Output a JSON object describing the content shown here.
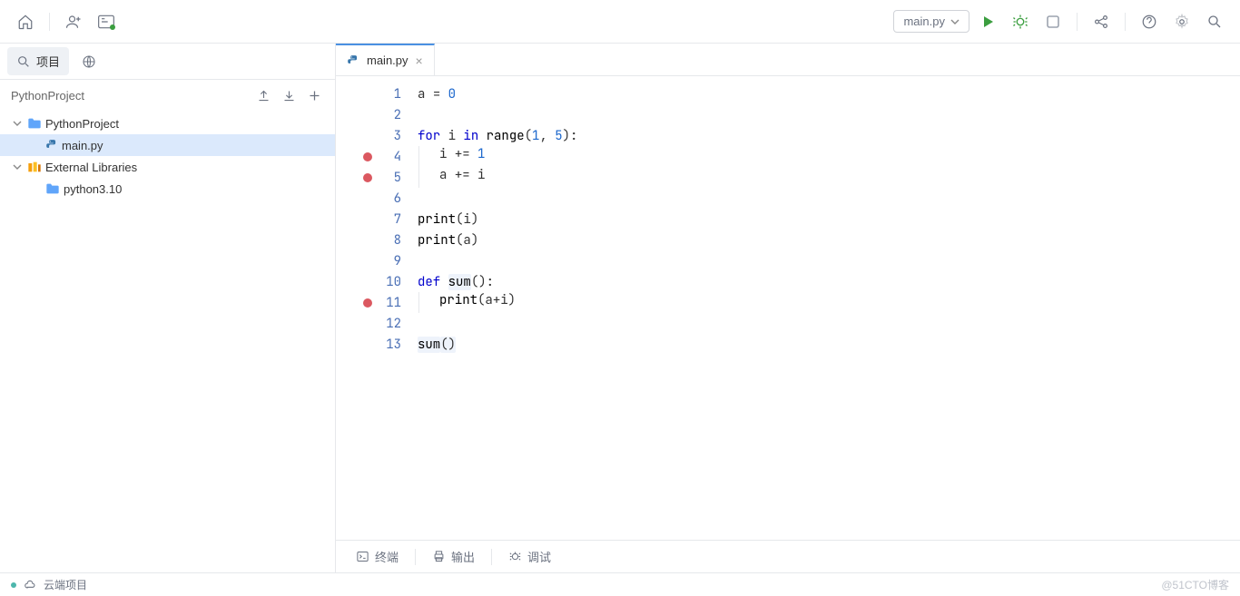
{
  "toolbar": {
    "run_config": "main.py"
  },
  "sidebar": {
    "tab_project": "项目",
    "header_title": "PythonProject",
    "tree": {
      "root": "PythonProject",
      "file_main": "main.py",
      "ext_lib": "External Libraries",
      "python_ver": "python3.10"
    }
  },
  "editor": {
    "tab_name": "main.py",
    "lines": [
      {
        "n": 1,
        "bp": false
      },
      {
        "n": 2,
        "bp": false
      },
      {
        "n": 3,
        "bp": false
      },
      {
        "n": 4,
        "bp": true
      },
      {
        "n": 5,
        "bp": true
      },
      {
        "n": 6,
        "bp": false
      },
      {
        "n": 7,
        "bp": false
      },
      {
        "n": 8,
        "bp": false
      },
      {
        "n": 9,
        "bp": false
      },
      {
        "n": 10,
        "bp": false
      },
      {
        "n": 11,
        "bp": true
      },
      {
        "n": 12,
        "bp": false
      },
      {
        "n": 13,
        "bp": false
      }
    ],
    "code": {
      "l1_a": "a ",
      "l1_eq": "= ",
      "l1_zero": "0",
      "l3_for": "for ",
      "l3_i": "i ",
      "l3_in": "in ",
      "l3_range": "range",
      "l3_open": "(",
      "l3_1": "1",
      "l3_comma": ", ",
      "l3_5": "5",
      "l3_close": "):",
      "l4_i": "i ",
      "l4_op": "+= ",
      "l4_1": "1",
      "l5_a": "a ",
      "l5_op": "+= ",
      "l5_i": "i",
      "l7_print": "print",
      "l7_open": "(",
      "l7_i": "i",
      "l7_close": ")",
      "l8_print": "print",
      "l8_open": "(",
      "l8_a": "a",
      "l8_close": ")",
      "l10_def": "def ",
      "l10_sum": "sum",
      "l10_par": "():",
      "l11_print": "print",
      "l11_open": "(",
      "l11_a": "a",
      "l11_plus": "+",
      "l11_i": "i",
      "l11_close": ")",
      "l13_sum": "sum",
      "l13_par": "()"
    }
  },
  "bottom": {
    "terminal": "终端",
    "output": "输出",
    "debug": "调试"
  },
  "status": {
    "cloud": "云端项目",
    "watermark": "@51CTO博客"
  }
}
